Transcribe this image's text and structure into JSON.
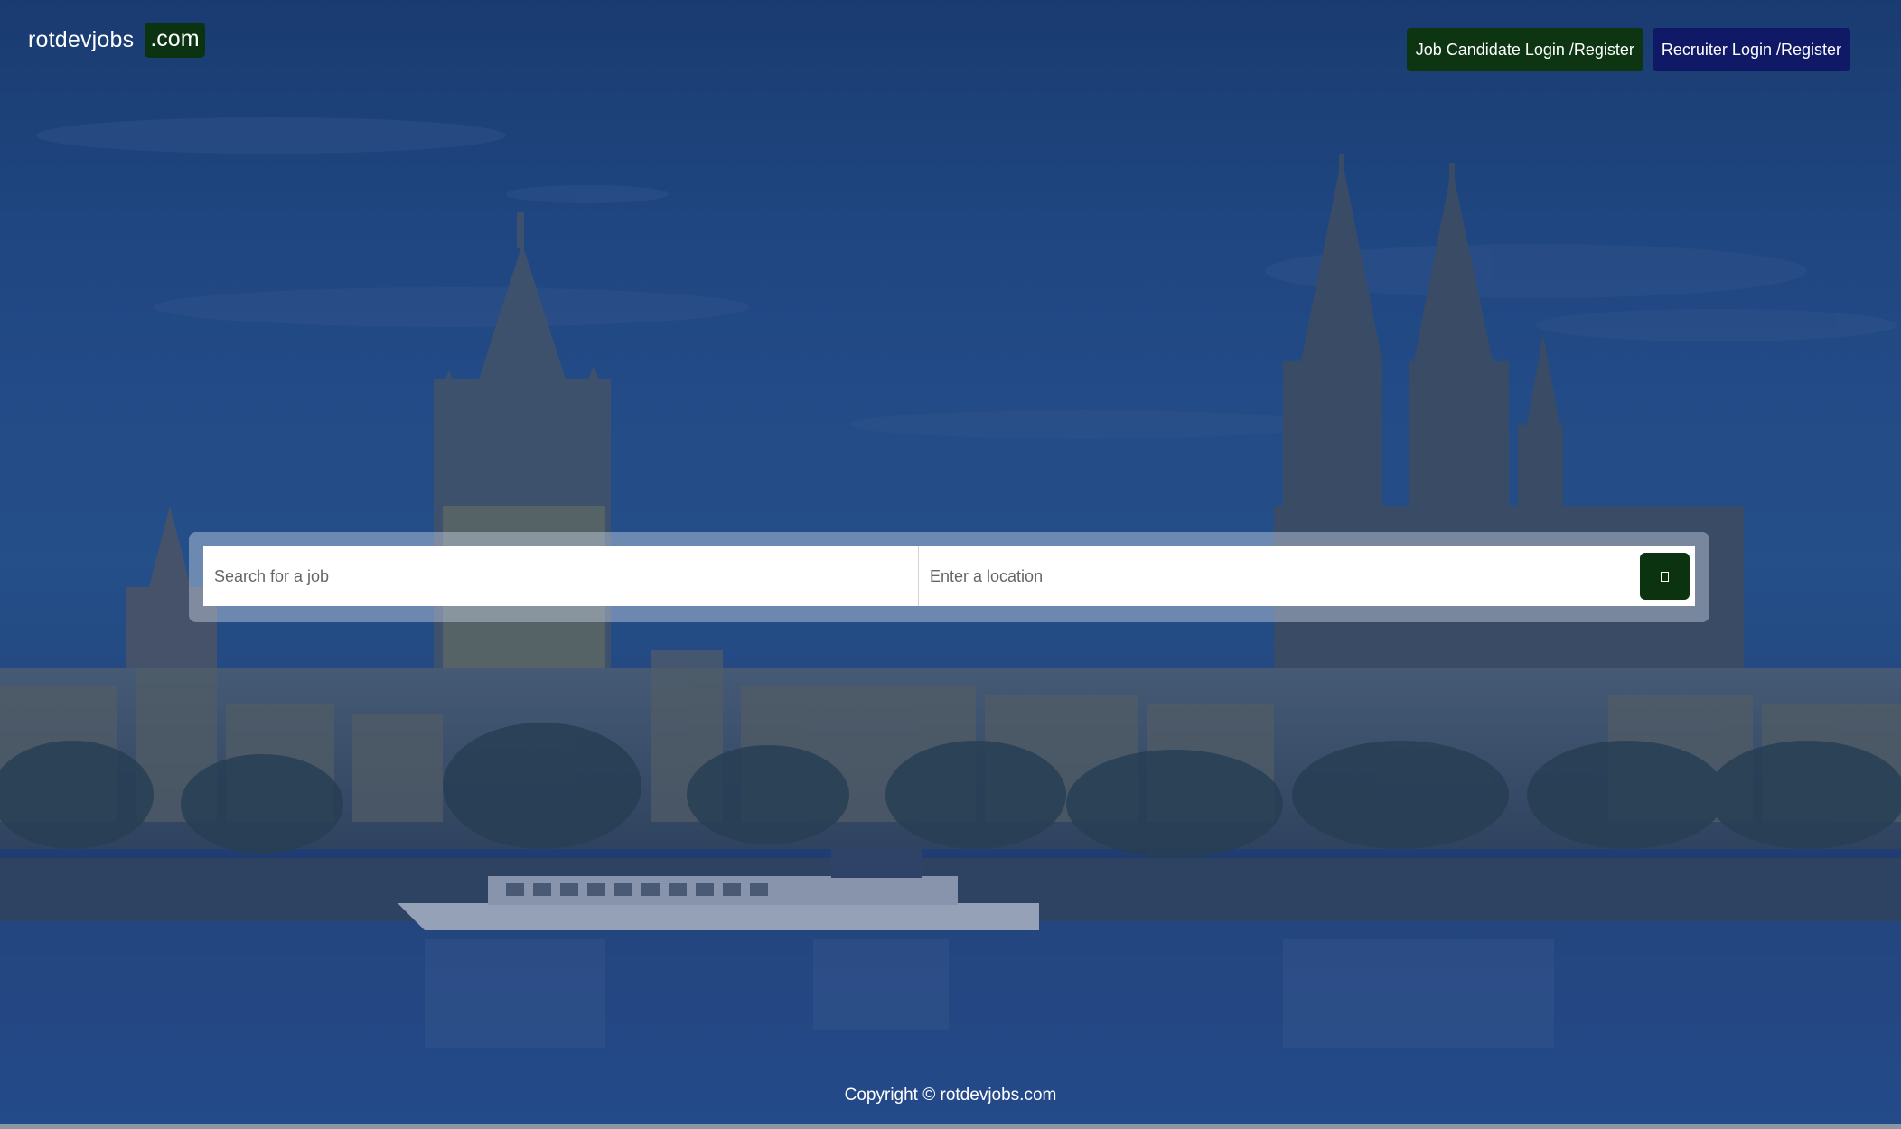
{
  "header": {
    "brand_name": "rotdevjobs",
    "brand_tld": ".com",
    "candidate_button": "Job Candidate Login /Register",
    "recruiter_button": "Recruiter Login /Register"
  },
  "search": {
    "job_placeholder": "Search for a job",
    "location_placeholder": "Enter a location",
    "button_icon": "search-icon"
  },
  "footer": {
    "copyright": "Copyright © rotdevjobs.com"
  },
  "colors": {
    "brand_tld_bg": "#0b3311",
    "candidate_button_bg": "#0d3512",
    "recruiter_button_bg": "#0f1966",
    "search_button_bg": "#0c3310",
    "overlay": "#1d3f72"
  },
  "background": {
    "scene": "cologne-skyline-night-icon"
  }
}
